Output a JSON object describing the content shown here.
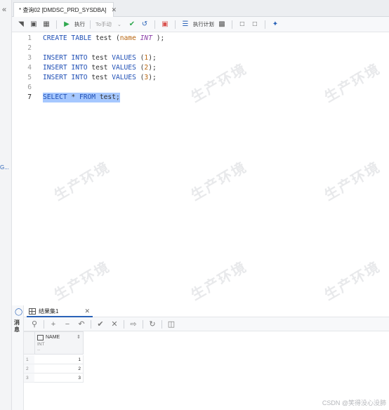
{
  "tab": {
    "title": "* 查询02 [DMDSC_PRD_SYSDBA]"
  },
  "toolbar": {
    "execute_label": "执行",
    "commit_mode_label": "To手动",
    "plan_label": "执行计划"
  },
  "editor": {
    "lines": [
      {
        "num": "1",
        "tokens": [
          {
            "t": "CREATE TABLE",
            "c": "kw"
          },
          {
            "t": " test (",
            "c": ""
          },
          {
            "t": "name",
            "c": "nm"
          },
          {
            "t": " ",
            "c": ""
          },
          {
            "t": "INT",
            "c": "type"
          },
          {
            "t": " );",
            "c": ""
          }
        ]
      },
      {
        "num": "2",
        "tokens": []
      },
      {
        "num": "3",
        "tokens": [
          {
            "t": "INSERT INTO",
            "c": "kw"
          },
          {
            "t": " test ",
            "c": ""
          },
          {
            "t": "VALUES",
            "c": "kw"
          },
          {
            "t": " (",
            "c": ""
          },
          {
            "t": "1",
            "c": "num"
          },
          {
            "t": ");",
            "c": ""
          }
        ]
      },
      {
        "num": "4",
        "tokens": [
          {
            "t": "INSERT INTO",
            "c": "kw"
          },
          {
            "t": " test ",
            "c": ""
          },
          {
            "t": "VALUES",
            "c": "kw"
          },
          {
            "t": " (",
            "c": ""
          },
          {
            "t": "2",
            "c": "num"
          },
          {
            "t": ");",
            "c": ""
          }
        ]
      },
      {
        "num": "5",
        "tokens": [
          {
            "t": "INSERT INTO",
            "c": "kw"
          },
          {
            "t": " test ",
            "c": ""
          },
          {
            "t": "VALUES",
            "c": "kw"
          },
          {
            "t": " (",
            "c": ""
          },
          {
            "t": "3",
            "c": "num"
          },
          {
            "t": ");",
            "c": ""
          }
        ]
      },
      {
        "num": "6",
        "tokens": []
      },
      {
        "num": "7",
        "tokens": [
          {
            "t": "SELECT",
            "c": "kw"
          },
          {
            "t": " * ",
            "c": ""
          },
          {
            "t": "FROM",
            "c": "kw"
          },
          {
            "t": " test;",
            "c": ""
          }
        ],
        "selected": true,
        "active": true
      }
    ]
  },
  "watermark": {
    "text": "生产环境"
  },
  "results": {
    "side_label": "消息",
    "tab_title": "结果集1",
    "column": {
      "name": "NAME",
      "type": "INT",
      "dash": "--"
    },
    "rows": [
      {
        "rn": "1",
        "value": "1"
      },
      {
        "rn": "2",
        "value": "2"
      },
      {
        "rn": "3",
        "value": "3"
      }
    ]
  },
  "left_rail": {
    "snippet": "G..."
  },
  "credit": "CSDN @笑得没心没肺"
}
